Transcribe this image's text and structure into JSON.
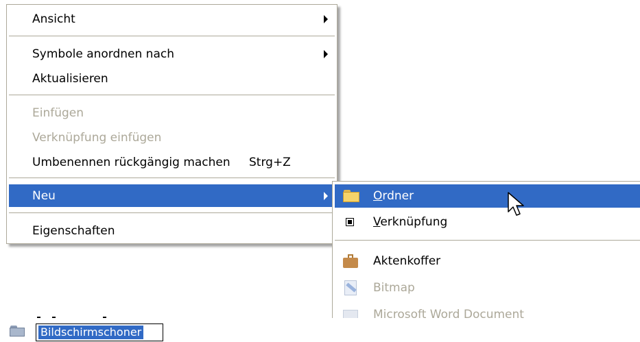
{
  "context_menu": {
    "items": [
      {
        "label": "Ansicht",
        "has_submenu": true,
        "state": "normal"
      },
      {
        "label": "Symbole anordnen nach",
        "has_submenu": true,
        "state": "normal"
      },
      {
        "label": "Aktualisieren",
        "state": "normal"
      },
      {
        "label": "Einfügen",
        "state": "disabled"
      },
      {
        "label": "Verknüpfung einfügen",
        "state": "disabled"
      },
      {
        "label": "Umbenennen rückgängig machen",
        "shortcut": "Strg+Z",
        "state": "normal"
      },
      {
        "label": "Neu",
        "has_submenu": true,
        "state": "selected"
      },
      {
        "label": "Eigenschaften",
        "state": "normal"
      }
    ]
  },
  "submenu_new": {
    "items": [
      {
        "accel": "O",
        "rest": "rdner",
        "icon": "folder-icon",
        "state": "selected"
      },
      {
        "accel": "V",
        "rest": "erknüpfung",
        "icon": "shortcut-icon",
        "state": "normal"
      },
      {
        "label": "Aktenkoffer",
        "icon": "briefcase-icon",
        "state": "normal"
      },
      {
        "label": "Bitmap",
        "icon": "bitmap-icon",
        "state": "disabled"
      },
      {
        "label": "Microsoft Word Document",
        "icon": "word-document-icon",
        "state": "disabled"
      }
    ]
  },
  "rename": {
    "value": "Bildschirmschoner"
  },
  "colors": {
    "selection": "#316ac5",
    "disabled_text": "#aca899",
    "border": "#aca899"
  }
}
